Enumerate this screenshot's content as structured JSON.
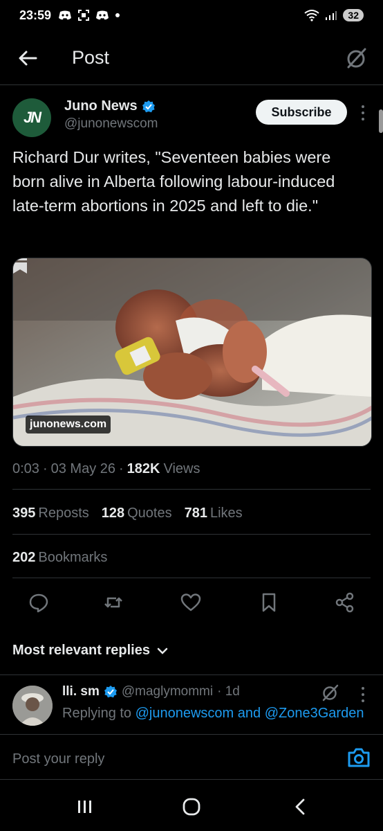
{
  "status_bar": {
    "time": "23:59",
    "battery": "32"
  },
  "header": {
    "title": "Post"
  },
  "author": {
    "avatar_text": "JN",
    "name": "Juno News",
    "handle": "@junonewscom",
    "subscribe_label": "Subscribe"
  },
  "tweet": {
    "text": "Richard Dur writes, \"Seventeen babies were born alive in Alberta following labour-induced late-term abortions in 2025 and left to die.\"",
    "media_domain": "junonews.com",
    "time": "0:03",
    "date": "03 May 26",
    "views_count": "182K",
    "views_label": "Views",
    "separator": "·"
  },
  "stats": {
    "reposts_count": "395",
    "reposts_label": "Reposts",
    "quotes_count": "128",
    "quotes_label": "Quotes",
    "likes_count": "781",
    "likes_label": "Likes",
    "bookmarks_count": "202",
    "bookmarks_label": "Bookmarks"
  },
  "replies": {
    "header": "Most relevant replies",
    "items": [
      {
        "name": "lli. sm",
        "handle": "@maglymommi",
        "age": "· 1d",
        "replying_prefix": "Replying to",
        "mention1": "@junonewscom",
        "and": "and",
        "mention2": "@Zone3Garden"
      }
    ]
  },
  "compose": {
    "placeholder": "Post your reply"
  },
  "colors": {
    "accent": "#1d9bf0",
    "background": "#000000",
    "muted": "#71767b",
    "brand_avatar": "#1e5b3a"
  }
}
